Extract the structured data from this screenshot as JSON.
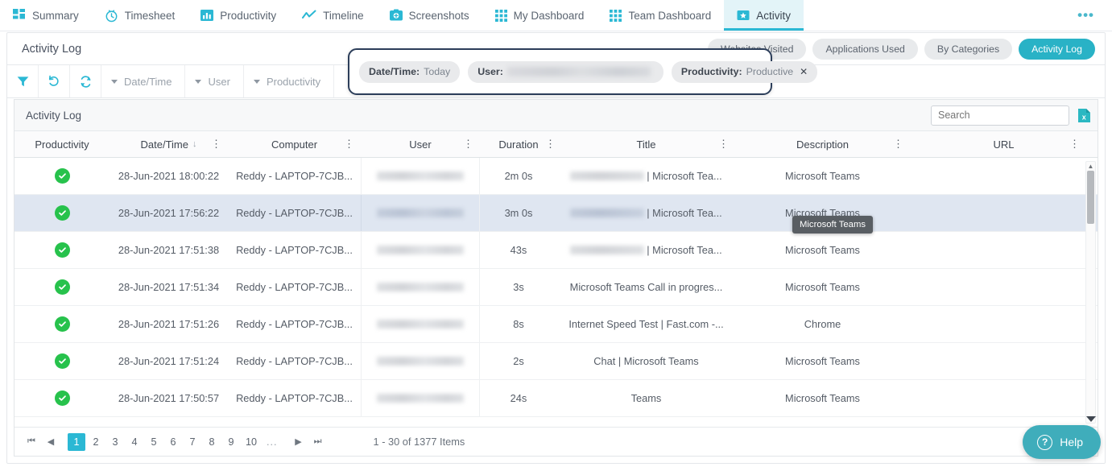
{
  "topnav": {
    "items": [
      {
        "label": "Summary",
        "icon": "grid-summary-icon",
        "active": false
      },
      {
        "label": "Timesheet",
        "icon": "clock-icon",
        "active": false
      },
      {
        "label": "Productivity",
        "icon": "bar-chart-icon",
        "active": false
      },
      {
        "label": "Timeline",
        "icon": "line-chart-icon",
        "active": false
      },
      {
        "label": "Screenshots",
        "icon": "camera-icon",
        "active": false
      },
      {
        "label": "My Dashboard",
        "icon": "grid-dashboard-icon",
        "active": false
      },
      {
        "label": "Team Dashboard",
        "icon": "grid-dashboard-icon",
        "active": false
      },
      {
        "label": "Activity",
        "icon": "star-badge-icon",
        "active": true
      }
    ],
    "more_label": "•••"
  },
  "page": {
    "title": "Activity Log",
    "segments": [
      {
        "label": "Websites Visited",
        "active": false
      },
      {
        "label": "Applications Used",
        "active": false
      },
      {
        "label": "By Categories",
        "active": false
      },
      {
        "label": "Activity Log",
        "active": true
      }
    ]
  },
  "toolbar": {
    "buttons": [
      {
        "name": "filter-icon",
        "title": "Filter"
      },
      {
        "name": "undo-icon",
        "title": "Reset"
      },
      {
        "name": "refresh-icon",
        "title": "Refresh"
      }
    ],
    "dropdowns": [
      {
        "label": "Date/Time"
      },
      {
        "label": "User"
      },
      {
        "label": "Productivity"
      }
    ]
  },
  "filter_chips": [
    {
      "key": "Date/Time:",
      "value": "Today",
      "redacted": false,
      "removable": false
    },
    {
      "key": "User:",
      "value": "",
      "redacted": true,
      "removable": false
    },
    {
      "key": "Productivity:",
      "value": "Productive",
      "redacted": false,
      "removable": true,
      "remove_icon": "✕"
    }
  ],
  "grid": {
    "header_title": "Activity Log",
    "search": {
      "value": "",
      "placeholder": "Search"
    },
    "export_icon": "excel-export-icon",
    "columns": [
      {
        "label": "Productivity",
        "kebab": false,
        "sort": ""
      },
      {
        "label": "Date/Time",
        "kebab": true,
        "sort": "↓"
      },
      {
        "label": "Computer",
        "kebab": true,
        "sort": ""
      },
      {
        "label": "User",
        "kebab": true,
        "sort": ""
      },
      {
        "label": "Duration",
        "kebab": true,
        "sort": ""
      },
      {
        "label": "Title",
        "kebab": true,
        "sort": ""
      },
      {
        "label": "Description",
        "kebab": true,
        "sort": ""
      },
      {
        "label": "URL",
        "kebab": true,
        "sort": ""
      }
    ],
    "rows": [
      {
        "productivity": "productive",
        "datetime": "28-Jun-2021 18:00:22",
        "computer": "Reddy - LAPTOP-7CJB...",
        "user_redacted": true,
        "duration": "2m 0s",
        "title_redacted": true,
        "title": "| Microsoft Tea...",
        "description": "Microsoft Teams",
        "url": "",
        "selected": false
      },
      {
        "productivity": "productive",
        "datetime": "28-Jun-2021 17:56:22",
        "computer": "Reddy - LAPTOP-7CJB...",
        "user_redacted": true,
        "duration": "3m 0s",
        "title_redacted": true,
        "title": "| Microsoft Tea...",
        "description": "Microsoft Teams",
        "url": "",
        "selected": true
      },
      {
        "productivity": "productive",
        "datetime": "28-Jun-2021 17:51:38",
        "computer": "Reddy - LAPTOP-7CJB...",
        "user_redacted": true,
        "duration": "43s",
        "title_redacted": true,
        "title": "| Microsoft Tea...",
        "description": "Microsoft Teams",
        "url": "",
        "selected": false
      },
      {
        "productivity": "productive",
        "datetime": "28-Jun-2021 17:51:34",
        "computer": "Reddy - LAPTOP-7CJB...",
        "user_redacted": true,
        "duration": "3s",
        "title_redacted": false,
        "title": "Microsoft Teams Call in progres...",
        "description": "Microsoft Teams",
        "url": "",
        "selected": false
      },
      {
        "productivity": "productive",
        "datetime": "28-Jun-2021 17:51:26",
        "computer": "Reddy - LAPTOP-7CJB...",
        "user_redacted": true,
        "duration": "8s",
        "title_redacted": false,
        "title": "Internet Speed Test | Fast.com -...",
        "description": "Chrome",
        "url": "",
        "selected": false
      },
      {
        "productivity": "productive",
        "datetime": "28-Jun-2021 17:51:24",
        "computer": "Reddy - LAPTOP-7CJB...",
        "user_redacted": true,
        "duration": "2s",
        "title_redacted": false,
        "title": "Chat | Microsoft Teams",
        "description": "Microsoft Teams",
        "url": "",
        "selected": false
      },
      {
        "productivity": "productive",
        "datetime": "28-Jun-2021 17:50:57",
        "computer": "Reddy - LAPTOP-7CJB...",
        "user_redacted": true,
        "duration": "24s",
        "title_redacted": false,
        "title": "Teams",
        "description": "Microsoft Teams",
        "url": "",
        "selected": false
      }
    ],
    "tooltip": {
      "text": "Microsoft Teams",
      "row_index": 2
    }
  },
  "pager": {
    "first_label": "⏮",
    "prev_label": "◀",
    "pages": [
      "1",
      "2",
      "3",
      "4",
      "5",
      "6",
      "7",
      "8",
      "9",
      "10"
    ],
    "active_page": "1",
    "dots": "...",
    "next_label": "▶",
    "last_label": "⏭",
    "info": "1 - 30 of 1377 Items"
  },
  "help": {
    "label": "Help",
    "icon": "question-circle-icon"
  },
  "colors": {
    "accent_teal": "#2bb8d4",
    "segment_active": "#29b2c6",
    "productive_green": "#27c24c",
    "highlight_border": "#2c3e5a",
    "selected_row": "#dfe6f1",
    "help_teal": "#3fadbb"
  }
}
